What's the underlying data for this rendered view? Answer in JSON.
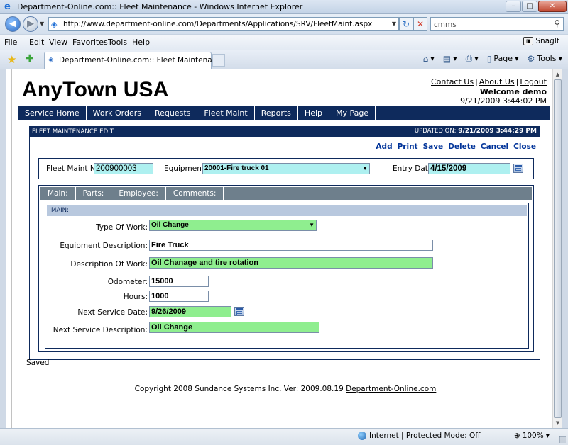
{
  "window": {
    "title": "Department-Online.com:: Fleet Maintenance - Windows Internet Explorer",
    "min_label": "–",
    "max_label": "□",
    "close_label": "✕"
  },
  "address": {
    "url": "http://www.department-online.com/Departments/Applications/SRV/FleetMaint.aspx",
    "search_value": "cmms"
  },
  "menu": {
    "items": [
      "File",
      "Edit",
      "View",
      "Favorites",
      "Tools",
      "Help"
    ],
    "snagit_label": "SnagIt"
  },
  "tab": {
    "label": "Department-Online.com:: Fleet Maintenance",
    "commands": [
      "Page",
      "Tools"
    ]
  },
  "site": {
    "brand": "AnyTown USA",
    "links": [
      "Contact Us",
      "About Us",
      "Logout"
    ],
    "welcome": "Welcome demo",
    "datetime": "9/21/2009 3:44:02 PM",
    "nav": [
      "Service Home",
      "Work Orders",
      "Requests",
      "Fleet Maint",
      "Reports",
      "Help",
      "My Page"
    ]
  },
  "form": {
    "header_title": "FLEET MAINTENANCE EDIT",
    "updated_label": "UPDATED ON:",
    "updated_value": "9/21/2009 3:44:29 PM",
    "actions": [
      "Add",
      "Print",
      "Save",
      "Delete",
      "Cancel",
      "Close"
    ],
    "fleet_maint_no_label": "Fleet Maint No.",
    "fleet_maint_no": "200900003",
    "equipment_label": "Equipment:",
    "equipment_value": "20001-Fire truck 01",
    "entry_date_label": "Entry Date:",
    "entry_date": "4/15/2009",
    "tabs": [
      "Main:",
      "Parts:",
      "Employee:",
      "Comments:"
    ],
    "panel_title": "MAIN:",
    "type_of_work_label": "Type Of Work:",
    "type_of_work": "Oil Change",
    "equipment_description_label": "Equipment Description:",
    "equipment_description": "Fire Truck",
    "description_of_work_label": "Description Of Work:",
    "description_of_work": "Oil Chanage and tire rotation",
    "odometer_label": "Odometer:",
    "odometer": "15000",
    "hours_label": "Hours:",
    "hours": "1000",
    "next_service_date_label": "Next Service Date:",
    "next_service_date": "9/26/2009",
    "next_service_description_label": "Next Service Description:",
    "next_service_description": "Oil Change",
    "status": "Saved"
  },
  "footer": {
    "copyright": "Copyright 2008 Sundance Systems Inc. Ver: 2009.08.19",
    "link": "Department-Online.com"
  },
  "statusbar": {
    "zone": "Internet | Protected Mode: Off",
    "zoom": "100%"
  },
  "colors": {
    "nav_bg": "#0e2a5c",
    "required_field": "#aef0f0",
    "edited_field": "#8fee8f",
    "tab_strip": "#6e7f8c",
    "panel_header": "#b8c8de"
  }
}
